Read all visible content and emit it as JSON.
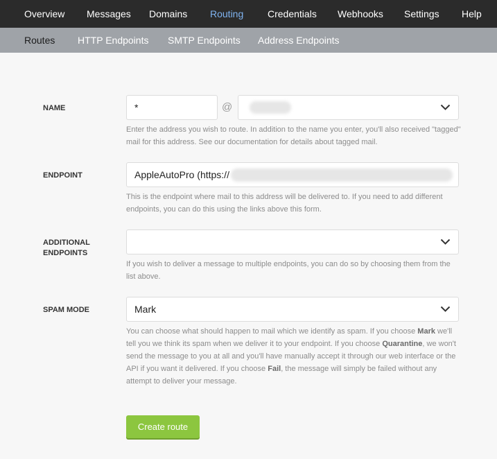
{
  "topnav": [
    {
      "label": "Overview"
    },
    {
      "label": "Messages"
    },
    {
      "label": "Domains"
    },
    {
      "label": "Routing",
      "active": true
    },
    {
      "label": "Credentials"
    },
    {
      "label": "Webhooks"
    },
    {
      "label": "Settings"
    },
    {
      "label": "Help"
    }
  ],
  "subnav": [
    {
      "label": "Routes",
      "active": true
    },
    {
      "label": "HTTP Endpoints"
    },
    {
      "label": "SMTP Endpoints"
    },
    {
      "label": "Address Endpoints"
    }
  ],
  "form": {
    "name": {
      "label": "NAME",
      "value": "*",
      "at": "@",
      "domain": "",
      "help": "Enter the address you wish to route. In addition to the name you enter, you'll also received \"tagged\" mail for this address. See our documentation for details about tagged mail."
    },
    "endpoint": {
      "label": "ENDPOINT",
      "value": "AppleAutoPro (https://",
      "help": "This is the endpoint where mail to this address will be delivered to. If you need to add different endpoints, you can do this using the links above this form."
    },
    "additional": {
      "label_line1": "ADDITIONAL",
      "label_line2": "ENDPOINTS",
      "value": "",
      "help": "If you wish to deliver a message to multiple endpoints, you can do so by choosing them from the list above."
    },
    "spam": {
      "label": "SPAM MODE",
      "value": "Mark",
      "help_1": "You can choose what should happen to mail which we identify as spam. If you choose ",
      "help_mark": "Mark",
      "help_2": " we'll tell you we think its spam when we deliver it to your endpoint. If you choose ",
      "help_quarantine": "Quarantine",
      "help_3": ", we won't send the message to you at all and you'll have manually accept it through our web interface or the API if you want it delivered. If you choose ",
      "help_fail": "Fail",
      "help_4": ", the message will simply be failed without any attempt to deliver your message."
    }
  },
  "button": {
    "label": "Create route"
  }
}
